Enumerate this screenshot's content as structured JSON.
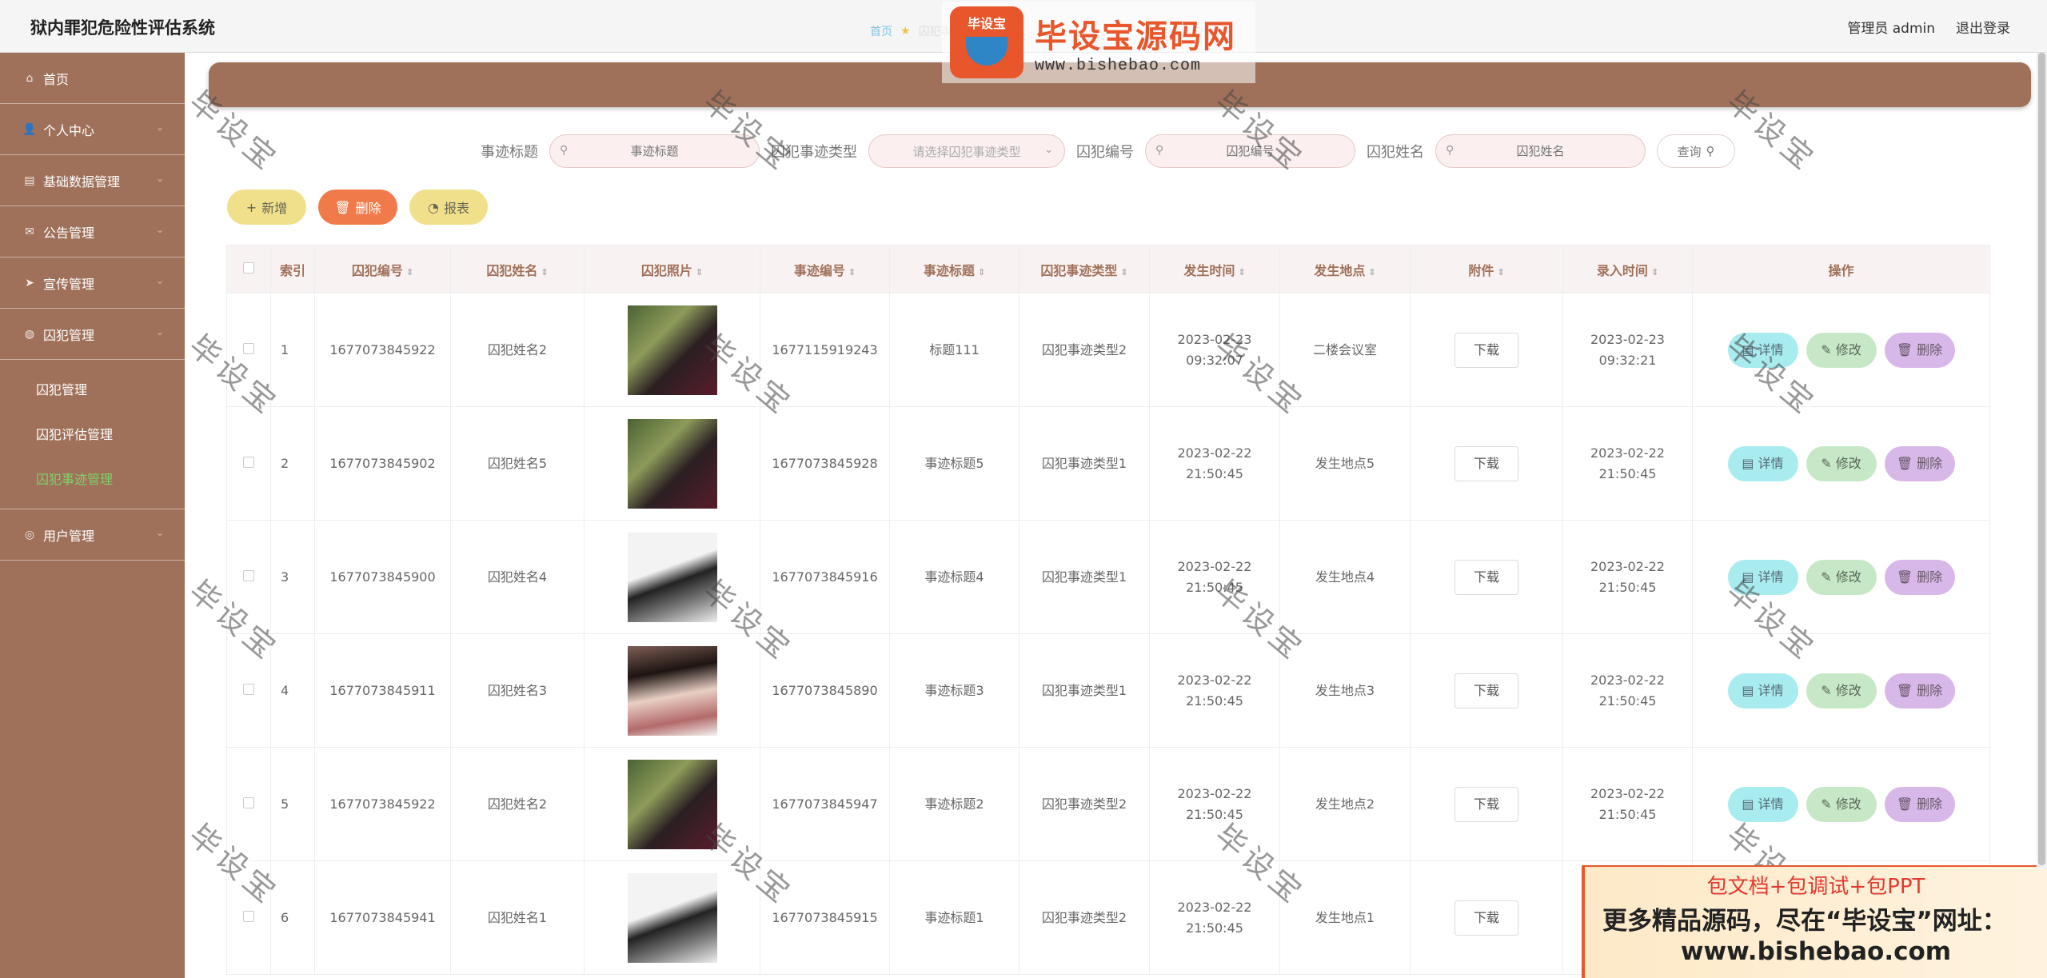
{
  "header": {
    "app_title": "狱内罪犯危险性评估系统",
    "user_label": "管理员 admin",
    "logout_label": "退出登录"
  },
  "watermark": {
    "badge_text": "毕设宝",
    "brand": "毕设宝源码网",
    "url": "www.bishebao.com",
    "stamp": "毕设宝"
  },
  "sidebar": {
    "items": [
      {
        "label": "首页",
        "icon": "home-icon"
      },
      {
        "label": "个人中心",
        "icon": "user-icon"
      },
      {
        "label": "基础数据管理",
        "icon": "database-icon"
      },
      {
        "label": "公告管理",
        "icon": "notice-icon"
      },
      {
        "label": "宣传管理",
        "icon": "send-icon"
      },
      {
        "label": "囚犯管理",
        "icon": "prisoner-icon"
      }
    ],
    "sub_items": [
      {
        "label": "囚犯管理"
      },
      {
        "label": "囚犯评估管理"
      },
      {
        "label": "囚犯事迹管理"
      }
    ],
    "last_item": {
      "label": "用户管理",
      "icon": "users-icon"
    }
  },
  "breadcrumb": {
    "home": "首页",
    "current": "囚犯事迹"
  },
  "search": {
    "title_label": "事迹标题",
    "title_placeholder": "事迹标题",
    "type_label": "囚犯事迹类型",
    "type_placeholder": "请选择囚犯事迹类型",
    "prisoner_no_label": "囚犯编号",
    "prisoner_no_placeholder": "囚犯编号",
    "prisoner_name_label": "囚犯姓名",
    "prisoner_name_placeholder": "囚犯姓名",
    "query_label": "查询"
  },
  "toolbar": {
    "add_label": "新增",
    "delete_label": "删除",
    "report_label": "报表"
  },
  "table": {
    "columns": [
      "索引",
      "囚犯编号",
      "囚犯姓名",
      "囚犯照片",
      "事迹编号",
      "事迹标题",
      "囚犯事迹类型",
      "发生时间",
      "发生地点",
      "附件",
      "录入时间",
      "操作"
    ],
    "download_label": "下载",
    "detail_label": "详情",
    "edit_label": "修改",
    "remove_label": "删除",
    "rows": [
      {
        "index": "1",
        "prisoner_no": "1677073845922",
        "prisoner_name": "囚犯姓名2",
        "photo": "p1",
        "deed_no": "1677115919243",
        "deed_title": "标题111",
        "deed_type": "囚犯事迹类型2",
        "occur_time": "2023-02-23 09:32:07",
        "location": "二楼会议室",
        "entry_time": "2023-02-23 09:32:21"
      },
      {
        "index": "2",
        "prisoner_no": "1677073845902",
        "prisoner_name": "囚犯姓名5",
        "photo": "p1",
        "deed_no": "1677073845928",
        "deed_title": "事迹标题5",
        "deed_type": "囚犯事迹类型1",
        "occur_time": "2023-02-22 21:50:45",
        "location": "发生地点5",
        "entry_time": "2023-02-22 21:50:45"
      },
      {
        "index": "3",
        "prisoner_no": "1677073845900",
        "prisoner_name": "囚犯姓名4",
        "photo": "p2",
        "deed_no": "1677073845916",
        "deed_title": "事迹标题4",
        "deed_type": "囚犯事迹类型1",
        "occur_time": "2023-02-22 21:50:45",
        "location": "发生地点4",
        "entry_time": "2023-02-22 21:50:45"
      },
      {
        "index": "4",
        "prisoner_no": "1677073845911",
        "prisoner_name": "囚犯姓名3",
        "photo": "p3",
        "deed_no": "1677073845890",
        "deed_title": "事迹标题3",
        "deed_type": "囚犯事迹类型1",
        "occur_time": "2023-02-22 21:50:45",
        "location": "发生地点3",
        "entry_time": "2023-02-22 21:50:45"
      },
      {
        "index": "5",
        "prisoner_no": "1677073845922",
        "prisoner_name": "囚犯姓名2",
        "photo": "p1",
        "deed_no": "1677073845947",
        "deed_title": "事迹标题2",
        "deed_type": "囚犯事迹类型2",
        "occur_time": "2023-02-22 21:50:45",
        "location": "发生地点2",
        "entry_time": "2023-02-22 21:50:45"
      },
      {
        "index": "6",
        "prisoner_no": "1677073845941",
        "prisoner_name": "囚犯姓名1",
        "photo": "p2",
        "deed_no": "1677073845915",
        "deed_title": "事迹标题1",
        "deed_type": "囚犯事迹类型2",
        "occur_time": "2023-02-22 21:50:45",
        "location": "发生地点1",
        "entry_time": ""
      }
    ]
  },
  "promo": {
    "line1": "包文档+包调试+包PPT",
    "line2": "更多精品源码，尽在“毕设宝”网址：",
    "line3": "www.bishebao.com"
  },
  "colors": {
    "sidebar_bg": "#a0715a",
    "active_sub": "#7cd26a",
    "header_accent": "#a0715a"
  }
}
